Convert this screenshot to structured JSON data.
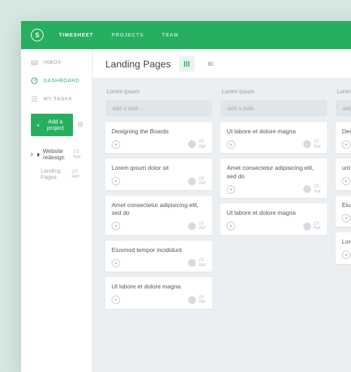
{
  "brand_letter": "S",
  "topnav": {
    "timesheet": "TIMESHEET",
    "projects": "PROJECTS",
    "team": "TEAM"
  },
  "sidebar": {
    "inbox": "INBOX",
    "dashboard": "DASHBOARD",
    "mytasks": "MY TASKS",
    "add_project": "Add a project",
    "project": {
      "name": "Website redesign",
      "date": "23 Apr"
    },
    "subproject": {
      "name": "Landing Pages",
      "date": "23 Apr"
    }
  },
  "page_title": "Landing Pages",
  "add_task_placeholder": "add a task...",
  "card_date_day": "23",
  "card_date_mon": "Apr",
  "columns": [
    {
      "title": "Lorem ipsum",
      "cards": [
        "Designing the Boards",
        "Lorem ipsum dolor sit",
        "Amet consectetur adipisicing elit, sed do",
        "Eiusmod tempor incididunt",
        "Ut labore et dolore magna"
      ]
    },
    {
      "title": "Lorem ipsum",
      "cards": [
        "Ut labore et dolore magna",
        "Amet consectetur adipisicing elit, sed do",
        "Ut labore et dolore magna"
      ]
    },
    {
      "title": "Lorem ipsum",
      "cards": [
        "Designin",
        "unt ut la",
        "Eiusmod",
        "Lorem ip"
      ]
    }
  ]
}
